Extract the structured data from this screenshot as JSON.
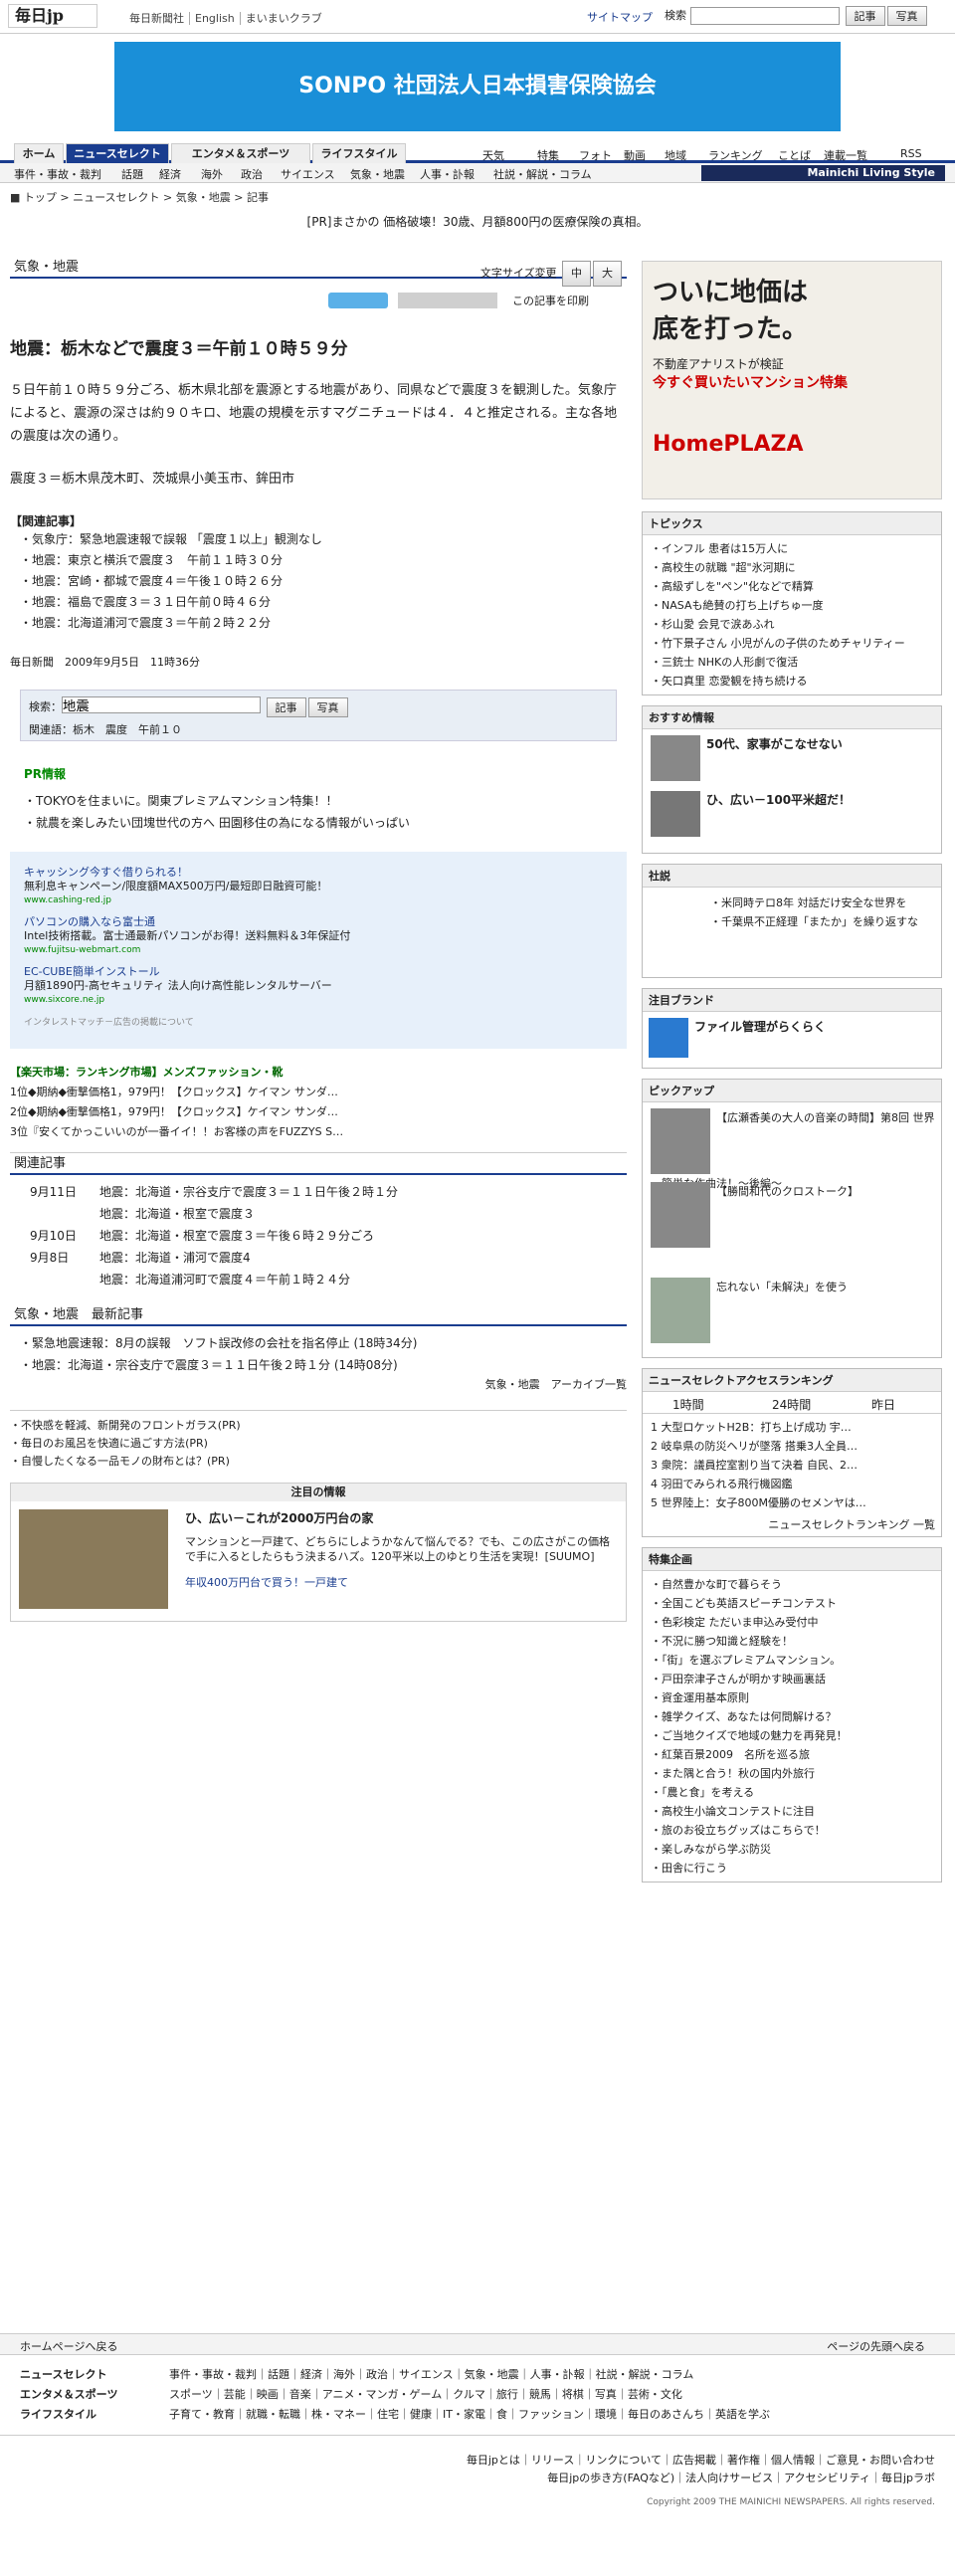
{
  "header": {
    "logo": "毎日jp",
    "links": [
      "毎日新聞社",
      "English",
      "まいまいクラブ"
    ],
    "sitemap": "サイトマップ",
    "search_label": "検索",
    "btn_article": "記事",
    "btn_photo": "写真"
  },
  "banner": {
    "text": "SONPO 社団法人日本損害保険協会"
  },
  "gnav": {
    "tabs": [
      "ホーム",
      "ニュースセレクト",
      "エンタメ＆スポーツ",
      "ライフスタイル"
    ],
    "subs": [
      "天気",
      "特集",
      "フォト",
      "動画",
      "地域",
      "ランキング",
      "ことば",
      "連載一覧",
      "RSS"
    ]
  },
  "snav": {
    "items": [
      "事件・事故・裁判",
      "話題",
      "経済",
      "海外",
      "政治",
      "サイエンス",
      "気象・地震",
      "人事・訃報",
      "社説・解説・コラム"
    ],
    "brand": "Mainichi Living Style"
  },
  "breadcrumb": {
    "items": [
      "トップ",
      "ニュースセレクト",
      "気象・地震",
      "記事"
    ]
  },
  "pr_line": "[PR]まさかの 価格破壊！30歳、月額800円の医療保険の真相。",
  "section": {
    "title": "気象・地震",
    "font_size": "文字サイズ変更",
    "print": "この記事を印刷"
  },
  "article": {
    "title": "地震：栃木などで震度３＝午前１０時５９分",
    "p1": "５日午前１０時５９分ごろ、栃木県北部を震源とする地震があり、同県などで震度３を観測した。気象庁によると、震源の深さは約９０キロ、地震の規模を示すマグニチュードは４．４と推定される。主な各地の震度は次の通り。",
    "p2": "震度３＝栃木県茂木町、茨城県小美玉市、鉾田市",
    "related_title": "【関連記事】",
    "related": [
      "気象庁：緊急地震速報で誤報 「震度１以上」観測なし",
      "地震：東京と横浜で震度３　午前１１時３０分",
      "地震：宮崎・都城で震度４＝午後１０時２６分",
      "地震：福島で震度３＝３１日午前０時４６分",
      "地震：北海道浦河で震度３＝午前２時２２分"
    ],
    "date": "毎日新聞　2009年9月5日　11時36分"
  },
  "kw": {
    "label": "検索：",
    "value": "地震",
    "related": "関連語：栃木　震度　午前１０"
  },
  "prinfo": {
    "title": "PR情報",
    "items": [
      "TOKYOを住まいに。関東プレミアムマンション特集！！",
      "就農を楽しみたい団塊世代の方へ 田園移住の為になる情報がいっぱい"
    ]
  },
  "ads": [
    {
      "t": "キャッシング今すぐ借りられる！",
      "d": "無利息キャンペーン/限度額MAX500万円/最短即日融資可能！",
      "u": "www.cashing-red.jp"
    },
    {
      "t": "パソコンの購入なら富士通",
      "d": "Intel技術搭載。富士通最新パソコンがお得！送料無料＆3年保証付",
      "u": "www.fujitsu-webmart.com"
    },
    {
      "t": "EC-CUBE簡単インストール",
      "d": "月額1890円-高セキュリティ 法人向け高性能レンタルサーバー",
      "u": "www.sixcore.ne.jp"
    }
  ],
  "ads_note": "インタレストマッチ－広告の掲載について",
  "rakuten": {
    "title": "【楽天市場：ランキング市場】メンズファッション・靴",
    "items": [
      "1位◆期納◆衝撃価格1，979円！【クロックス】ケイマン サンダ…",
      "2位◆期納◆衝撃価格1，979円！【クロックス】ケイマン サンダ…",
      "3位『安くてかっこいいのが一番イイ！！お客様の声をFUZZYS S…"
    ]
  },
  "rel2": {
    "title": "関連記事",
    "rows": [
      {
        "d": "9月11日",
        "t": "地震：北海道・宗谷支庁で震度３＝１１日午後２時１分"
      },
      {
        "d": "",
        "t": "地震：北海道・根室で震度３"
      },
      {
        "d": "9月10日",
        "t": "地震：北海道・根室で震度３＝午後６時２９分ごろ"
      },
      {
        "d": "9月8日",
        "t": "地震：北海道・浦河で震度4"
      },
      {
        "d": "",
        "t": "地震：北海道浦河町で震度４＝午前１時２４分"
      }
    ]
  },
  "newest": {
    "title": "気象・地震　最新記事",
    "items": [
      "緊急地震速報：8月の誤報　ソフト誤改修の会社を指名停止 (18時34分)",
      "地震：北海道・宗谷支庁で震度３＝１１日午後２時１分 (14時08分)"
    ],
    "archive": "気象・地震　アーカイブ一覧"
  },
  "mini": [
    "不快感を軽減、新開発のフロントガラス(PR)",
    "毎日のお風呂を快適に過ごす方法(PR)",
    "自慢したくなる一品モノの財布とは？(PR)"
  ],
  "feat": {
    "title": "注目の情報",
    "head": "ひ、広い－これが2000万円台の家",
    "body": "マンションと一戸建て、どちらにしようかなんて悩んでる？でも、この広さがこの価格で手に入るとしたらもう決まるハズ。120平米以上のゆとり生活を実現！[SUUMO]",
    "link": "年収400万円台で買う！一戸建て"
  },
  "side_ad": {
    "line1": "ついに地価は",
    "line2": "底を打った。",
    "line3": "不動産アナリストが検証",
    "line4": "今すぐ買いたいマンション特集",
    "brand": "HomePLAZA"
  },
  "topics": {
    "title": "トピックス",
    "items": [
      "インフル 患者は15万人に",
      "高校生の就職 \"超\"氷河期に",
      "高級ずしを\"ペン\"化などで精算",
      "NASAも絶賛の打ち上げちゅ一度",
      "杉山愛 会見で涙あふれ",
      "竹下景子さん 小児がんの子供のためチャリティー",
      "三銃士 NHKの人形劇で復活",
      "矢口真里 恋愛観を持ち続ける"
    ]
  },
  "recommend": {
    "title": "おすすめ情報",
    "items": [
      "50代、家事がこなせない",
      "ひ、広い－100平米超だ！"
    ]
  },
  "editorial": {
    "title": "社説",
    "items": [
      "米同時テロ8年 対話だけ安全な世界を",
      "千葉県不正経理「またか」を繰り返すな"
    ]
  },
  "brand": {
    "title": "注目ブランド",
    "head": "ファイル管理がらくらく"
  },
  "pickup": {
    "title": "ピックアップ",
    "items": [
      "【広瀬香美の大人の音楽の時間】第8回 世界一簡単な作曲法！～後編～",
      "【勝間和代のクロストーク】",
      "忘れない「未解決」を使う"
    ]
  },
  "ranking": {
    "title": "ニュースセレクトアクセスランキング",
    "tabs": [
      "1時間",
      "24時間",
      "昨日"
    ],
    "items": [
      "大型ロケットH2B：打ち上げ成功 宇…",
      "岐阜県の防災ヘリが墜落 搭乗3人全員…",
      "衆院：議員控室割り当て決着 自民、2…",
      "羽田でみられる飛行機図鑑",
      "世界陸上：女子800M優勝のセメンヤは…"
    ],
    "more": "ニュースセレクトランキング 一覧"
  },
  "specials": {
    "title": "特集企画",
    "items": [
      "自然豊かな町で暮らそう",
      "全国こども英語スピーチコンテスト",
      "色彩検定 ただいま申込み受付中",
      "不況に勝つ知識と経験を！",
      "「街」を選ぶプレミアムマンション。",
      "戸田奈津子さんが明かす映画裏話",
      "資金運用基本原則",
      "雑学クイズ、あなたは何問解ける？",
      "ご当地クイズで地域の魅力を再発見！",
      "紅葉百景2009　名所を巡る旅",
      "また隅と合う！秋の国内外旅行",
      "「農と食」を考える",
      "高校生小論文コンテストに注目",
      "旅のお役立ちグッズはこちらで！",
      "楽しみながら学ぶ防災",
      "田舎に行こう"
    ]
  },
  "footer": {
    "back": "ホームページへ戻る",
    "top": "ページの先頭へ戻る",
    "rows": [
      {
        "h": "ニュースセレクト",
        "t": "事件・事故・裁判｜話題｜経済｜海外｜政治｜サイエンス｜気象・地震｜人事・訃報｜社説・解説・コラム"
      },
      {
        "h": "エンタメ＆スポーツ",
        "t": "スポーツ｜芸能｜映画｜音楽｜アニメ・マンガ・ゲーム｜クルマ｜旅行｜競馬｜将棋｜写真｜芸術・文化"
      },
      {
        "h": "ライフスタイル",
        "t": "子育て・教育｜就職・転職｜株・マネー｜住宅｜健康｜IT・家電｜食｜ファッション｜環境｜毎日のあさんち｜英語を学ぶ"
      }
    ],
    "links": "毎日jpとは｜リリース｜リンクについて｜広告掲載｜著作権｜個人情報｜ご意見・お問い合わせ",
    "links2": "毎日jpの歩き方(FAQなど)｜法人向けサービス｜アクセシビリティ｜毎日jpラボ",
    "copy": "Copyright 2009 THE MAINICHI NEWSPAPERS. All rights reserved."
  }
}
